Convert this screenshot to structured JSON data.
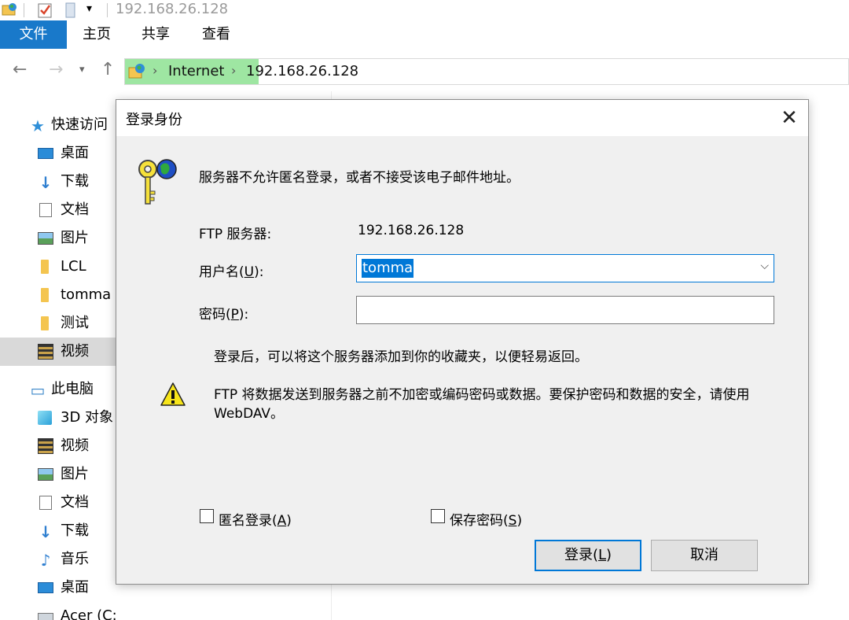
{
  "window": {
    "title": "192.168.26.128"
  },
  "ribbon": {
    "tabs": [
      "文件",
      "主页",
      "共享",
      "查看"
    ]
  },
  "address": {
    "crumbs": [
      "Internet",
      "192.168.26.128"
    ]
  },
  "nav": {
    "quick_access": "快速访问",
    "quick_items": [
      "桌面",
      "下载",
      "文档",
      "图片",
      "LCL",
      "tomma",
      "测试",
      "视频"
    ],
    "this_pc": "此电脑",
    "pc_items": [
      "3D 对象",
      "视频",
      "图片",
      "文档",
      "下载",
      "音乐",
      "桌面",
      "Acer (C:)"
    ]
  },
  "dialog": {
    "title": "登录身份",
    "message": "服务器不允许匿名登录，或者不接受该电子邮件地址。",
    "ftp_server_label": "FTP 服务器:",
    "ftp_server_value": "192.168.26.128",
    "username_label_pre": "用户名(",
    "username_label_key": "U",
    "username_label_post": "):",
    "username_value": "tomma",
    "password_label_pre": "密码(",
    "password_label_key": "P",
    "password_label_post": "):",
    "password_value": "",
    "info_text": "登录后，可以将这个服务器添加到你的收藏夹，以便轻易返回。",
    "warning_line1": "FTP 将数据发送到服务器之前不加密或编码密码或数据。要保护密码和数据的安全，请使用",
    "warning_line2": "WebDAV。",
    "anon_pre": "匿名登录(",
    "anon_key": "A",
    "anon_post": ")",
    "anon_checked": false,
    "save_pre": "保存密码(",
    "save_key": "S",
    "save_post": ")",
    "save_checked": false,
    "login_pre": "登录(",
    "login_key": "L",
    "login_post": ")",
    "cancel": "取消"
  },
  "icons": {
    "dialog_icon": "key-globe-icon",
    "warning_icon": "warning-icon",
    "close_icon": "close-icon"
  },
  "colors": {
    "accent": "#0078d7",
    "file_tab": "#1979ca",
    "address_highlight": "#9ee6a2",
    "selection": "#d9d9d9"
  }
}
